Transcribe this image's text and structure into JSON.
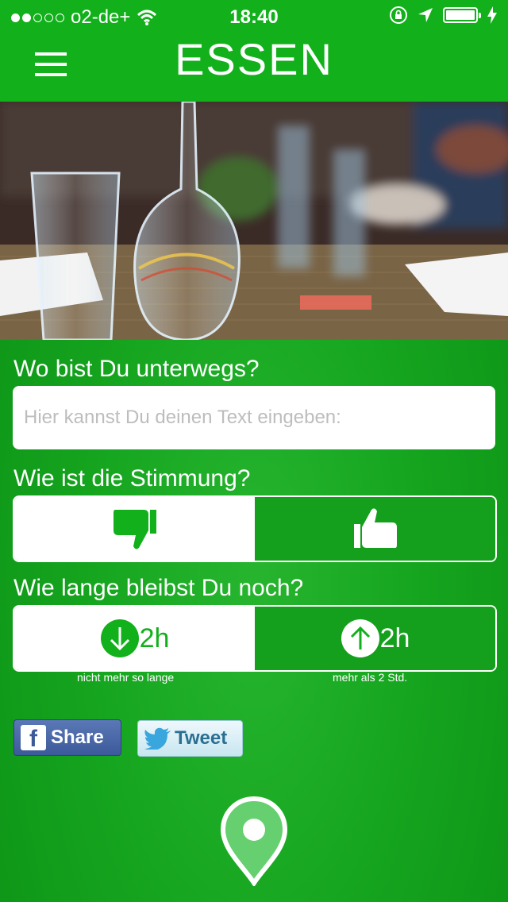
{
  "status": {
    "carrier": "o2-de+",
    "time": "18:40"
  },
  "header": {
    "title": "ESSEN"
  },
  "location": {
    "label": "Wo bist Du unterwegs?",
    "placeholder": "Hier kannst Du deinen Text eingeben:"
  },
  "mood": {
    "label": "Wie ist die Stimmung?"
  },
  "duration": {
    "label": "Wie lange bleibst Du noch?",
    "less": {
      "value": "2h",
      "hint": "nicht mehr so lange"
    },
    "more": {
      "value": "2h",
      "hint": "mehr als 2 Std."
    }
  },
  "share": {
    "facebook": "Share",
    "twitter": "Tweet"
  },
  "colors": {
    "brand_green": "#12b01b",
    "dark_green": "#14a01c",
    "facebook_blue": "#3c5a9a"
  },
  "icons": [
    "hamburger-menu-icon",
    "thumbs-down-icon",
    "thumbs-up-icon",
    "arrow-down-circle-icon",
    "arrow-up-circle-icon",
    "location-pin-icon"
  ]
}
